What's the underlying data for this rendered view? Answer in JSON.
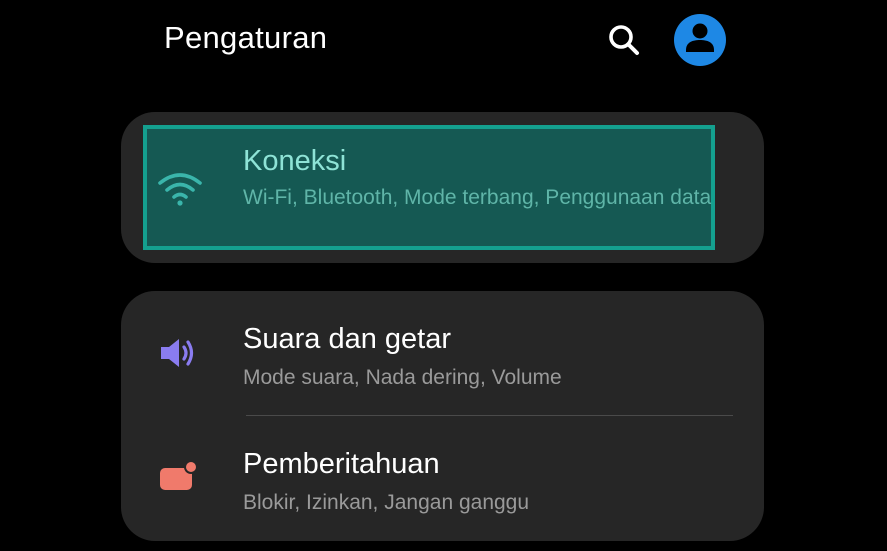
{
  "header": {
    "title": "Pengaturan",
    "search_icon": "search-icon",
    "avatar_icon": "account-icon",
    "avatar_color": "#1e88e5"
  },
  "items": [
    {
      "title": "Koneksi",
      "subtitle": "Wi-Fi, Bluetooth, Mode terbang, Penggunaan data",
      "icon": "wifi-icon",
      "icon_color": "#3ab5ab",
      "highlight_color": "#14a08f"
    },
    {
      "title": "Suara dan getar",
      "subtitle": "Mode suara, Nada dering, Volume",
      "icon": "volume-icon",
      "icon_color": "#8a7cf0"
    },
    {
      "title": "Pemberitahuan",
      "subtitle": "Blokir, Izinkan, Jangan ganggu",
      "icon": "notification-icon",
      "icon_color": "#f07a6b"
    }
  ]
}
